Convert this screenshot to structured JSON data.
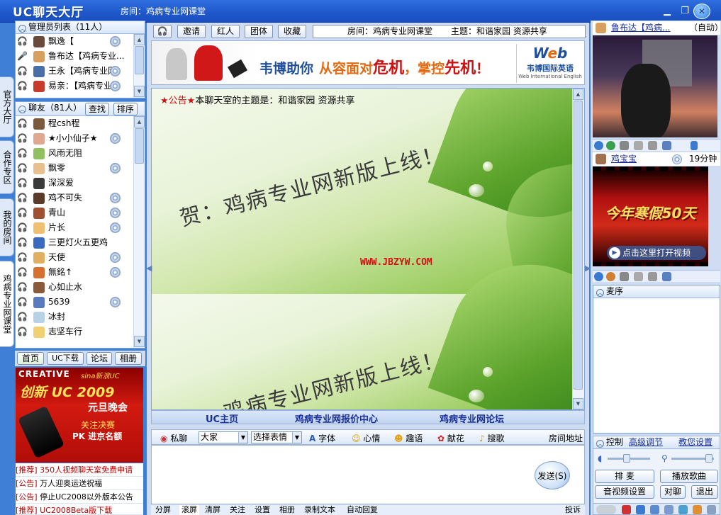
{
  "window": {
    "app_logo": "UC聊天大厅",
    "room_label": "房间：鸡病专业网课堂",
    "controls": [
      "minimize-icon",
      "restore-icon",
      "close-icon"
    ]
  },
  "side_tabs": [
    "官方大厅",
    "合作专区",
    "我的房间",
    "鸡病专业网课堂"
  ],
  "admins": {
    "header": "管理员列表（11人）",
    "rows": [
      {
        "name": "飘逸【"
      },
      {
        "name": "鲁布达【鸡病专业..."
      },
      {
        "name": "王永【鸡病专业网"
      },
      {
        "name": "易亲：【鸡病专业"
      }
    ]
  },
  "friends": {
    "header": "聊友（81人）",
    "find_label": "查找",
    "sort_label": "排序",
    "rows": [
      {
        "name": "程csh程"
      },
      {
        "name": "★小小仙子★"
      },
      {
        "name": "风雨无阻"
      },
      {
        "name": "飘零"
      },
      {
        "name": "深深爱"
      },
      {
        "name": "鸡不可失"
      },
      {
        "name": "青山"
      },
      {
        "name": "片长"
      },
      {
        "name": "三更灯火五更鸡"
      },
      {
        "name": "天使"
      },
      {
        "name": "無銘↑"
      },
      {
        "name": "心如止水"
      },
      {
        "name": "5639"
      },
      {
        "name": "冰封"
      },
      {
        "name": "志坚车行"
      }
    ]
  },
  "left_links": [
    "首页",
    "UC下载",
    "论坛",
    "相册"
  ],
  "left_ad": {
    "brand": "CREATIVE",
    "partner": "sina新浪UC",
    "headline": "创新 UC 2009",
    "sub": "元旦晚会",
    "line1": "关注决赛",
    "line2": "PK 进京名额"
  },
  "notices": [
    {
      "tag": "[推荐]",
      "text": "350人视频聊天室免费申请"
    },
    {
      "tag": "[公告]",
      "text": "万人迎奥运送祝福"
    },
    {
      "tag": "[公告]",
      "text": "停止UC2008以外版本公告"
    },
    {
      "tag": "[推荐]",
      "text": "UC2008Beta版下载"
    }
  ],
  "toolbar": {
    "buttons": [
      "邀请",
      "红人",
      "团体",
      "收藏"
    ],
    "room_info": "房间：鸡病专业网课堂",
    "topic_info": "主题：和谐家园 资源共享"
  },
  "banner": {
    "text1": "韦博助你",
    "text2": "从容面对",
    "text3": "危机",
    "text4": "，掌控",
    "text5": "先机",
    "text6": "！",
    "brand": "韦博国际英语",
    "brand_en": "Web International English"
  },
  "chat": {
    "notice_prefix": "★公告★",
    "notice_text": "本聊天室的主题是：和谐家园 资源共享",
    "img_line1": "贺：鸡病专业网新版上线！",
    "img_url": "WWW.JBZYW.COM"
  },
  "chat_links": [
    "UC主页",
    "鸡病专业网报价中心",
    "鸡病专业网论坛"
  ],
  "input_bar": {
    "private_label": "私聊",
    "target_value": "大家",
    "emotion_value": "选择表情",
    "font_label": "字体",
    "mood_label": "心情",
    "fun_label": "趣语",
    "flower_label": "献花",
    "song_label": "搜歌",
    "room_addr_label": "房间地址",
    "send_label": "发送(S)"
  },
  "bottom_tabs": [
    "分屏",
    "滚屏",
    "清屏",
    "关注",
    "设置",
    "相册",
    "录制文本",
    "自动回复"
  ],
  "bottom_right": "投诉",
  "right_panel": {
    "video1_user": "鲁布达【鸡病...",
    "video1_mode": "（自动）",
    "video2_user": "鸡宝宝",
    "video2_time": "19分钟",
    "video2_ad": "今年寒假50天",
    "video2_play": "点击这里打开视频",
    "mic_queue_header": "麦序",
    "control_label": "控制",
    "advanced_label": "高级调节",
    "tutorial_label": "教您设置",
    "btn_queue": "排   麦",
    "btn_play_song": "播放歌曲",
    "btn_av_settings": "音视频设置",
    "btn_private_chat": "对聊",
    "btn_exit": "退出"
  }
}
